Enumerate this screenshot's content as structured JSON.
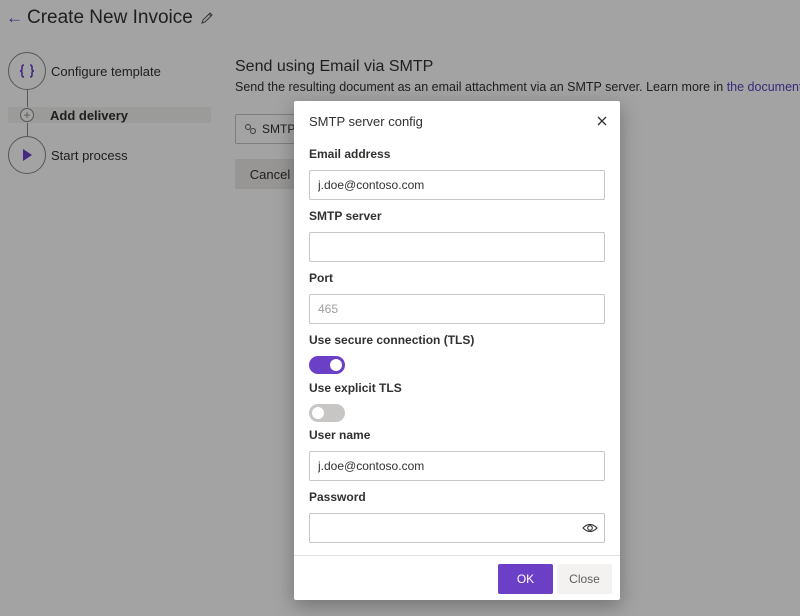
{
  "page": {
    "title": "Create New Invoice",
    "back_icon": "arrow-left-icon",
    "edit_icon": "pencil-icon"
  },
  "steps": [
    {
      "label": "Configure template",
      "icon": "braces-icon"
    },
    {
      "label": "Add delivery",
      "icon": "plus-circle-icon"
    },
    {
      "label": "Start process",
      "icon": "play-icon"
    }
  ],
  "main": {
    "heading": "Send using Email via SMTP",
    "description": "Send the resulting document as an email attachment via an SMTP server. Learn more in ",
    "link_text": "the documentation",
    "description_end": ".",
    "chip_label": "SMTP",
    "chip_icon": "gears-icon",
    "cancel_label": "Cancel"
  },
  "dialog": {
    "title": "SMTP server config",
    "fields": {
      "email": {
        "label": "Email address",
        "value": "j.doe@contoso.com",
        "placeholder": ""
      },
      "server": {
        "label": "SMTP server",
        "value": "",
        "placeholder": ""
      },
      "port": {
        "label": "Port",
        "value": "",
        "placeholder": "465"
      },
      "tls": {
        "label": "Use secure connection (TLS)",
        "on": true
      },
      "explicit_tls": {
        "label": "Use explicit TLS",
        "on": false
      },
      "username": {
        "label": "User name",
        "value": "j.doe@contoso.com",
        "placeholder": ""
      },
      "password": {
        "label": "Password",
        "value": "",
        "placeholder": ""
      }
    },
    "ok_label": "OK",
    "close_label": "Close"
  },
  "colors": {
    "accent": "#6c3fc7",
    "link": "#5b3fc4",
    "overlay": "rgba(0,0,0,0.36)"
  }
}
